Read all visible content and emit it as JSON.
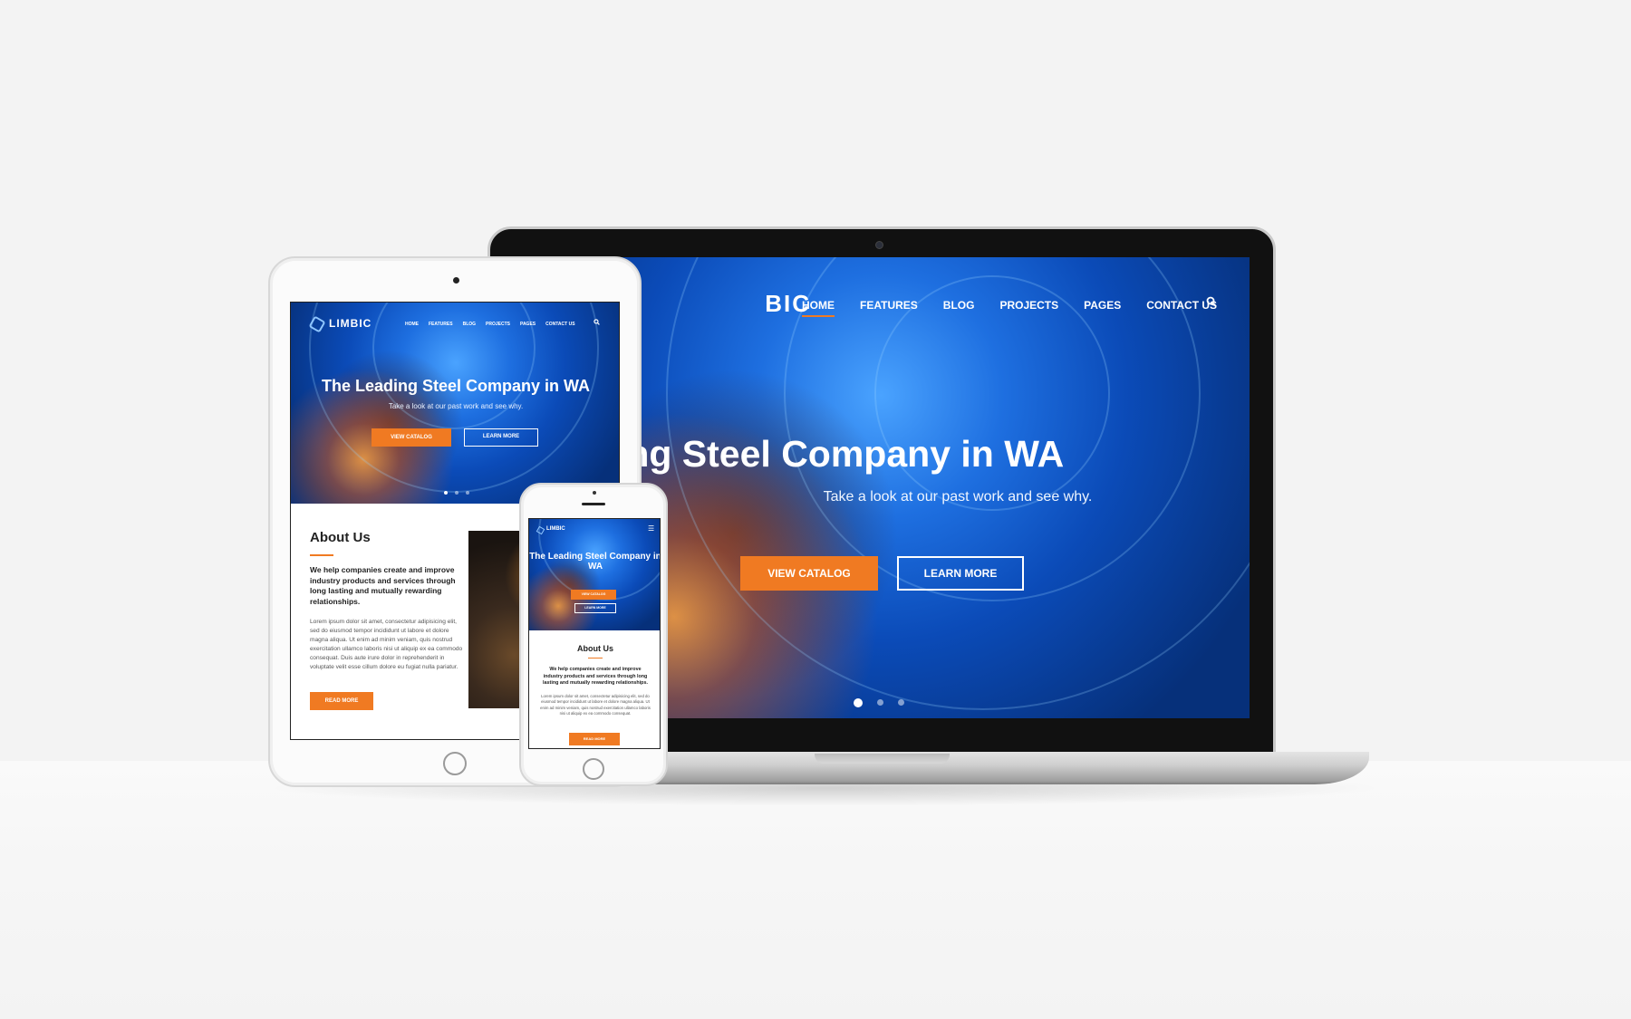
{
  "brand": {
    "logo": "LIMBIC",
    "accent_color": "#f07a22",
    "hero_color": "#1e6fe0"
  },
  "laptop": {
    "logo_visible": "BIC",
    "nav": [
      "HOME",
      "FEATURES",
      "BLOG",
      "PROJECTS",
      "PAGES",
      "CONTACT US"
    ],
    "active_nav": "HOME",
    "search_icon": "search-icon",
    "hero_title": "he Leading Steel Company in WA",
    "hero_subtitle": "Take a look at our past work and see why.",
    "primary_button": "VIEW CATALOG",
    "secondary_button": "LEARN MORE",
    "slides": 3,
    "active_slide": 1
  },
  "tablet": {
    "logo": "LIMBIC",
    "nav": [
      "HOME",
      "FEATURES",
      "BLOG",
      "PROJECTS",
      "PAGES",
      "CONTACT US"
    ],
    "hero_title": "The Leading Steel Company in WA",
    "hero_subtitle": "Take a look at our past work and see why.",
    "primary_button": "VIEW CATALOG",
    "secondary_button": "LEARN MORE",
    "about_title": "About Us",
    "about_lead": "We help companies create and improve industry products and services through long lasting and mutually rewarding relationships.",
    "about_body": "Lorem ipsum dolor sit amet, consectetur adipisicing elit, sed do eiusmod tempor incididunt ut labore et dolore magna aliqua. Ut enim ad minim veniam, quis nostrud exercitation ullamco laboris nisi ut aliquip ex ea commodo consequat. Duis aute irure dolor in reprehenderit in voluptate velit esse cillum dolore eu fugiat nulla pariatur.",
    "read_more": "READ MORE"
  },
  "phone": {
    "logo": "LIMBIC",
    "menu_icon": "hamburger-icon",
    "hero_title": "The Leading Steel Company in WA",
    "primary_button": "VIEW CATALOG",
    "secondary_button": "LEARN MORE",
    "about_title": "About Us",
    "about_lead": "We help companies create and improve industry products and services through long lasting and mutually rewarding relationships.",
    "about_body": "Lorem ipsum dolor sit amet, consectetur adipisicing elit, sed do eiusmod tempor incididunt ut labore et dolore magna aliqua. Ut enim ad minim veniam, quis nostrud exercitation ullamco laboris nisi ut aliquip ex ea commodo consequat.",
    "read_more": "READ MORE"
  }
}
